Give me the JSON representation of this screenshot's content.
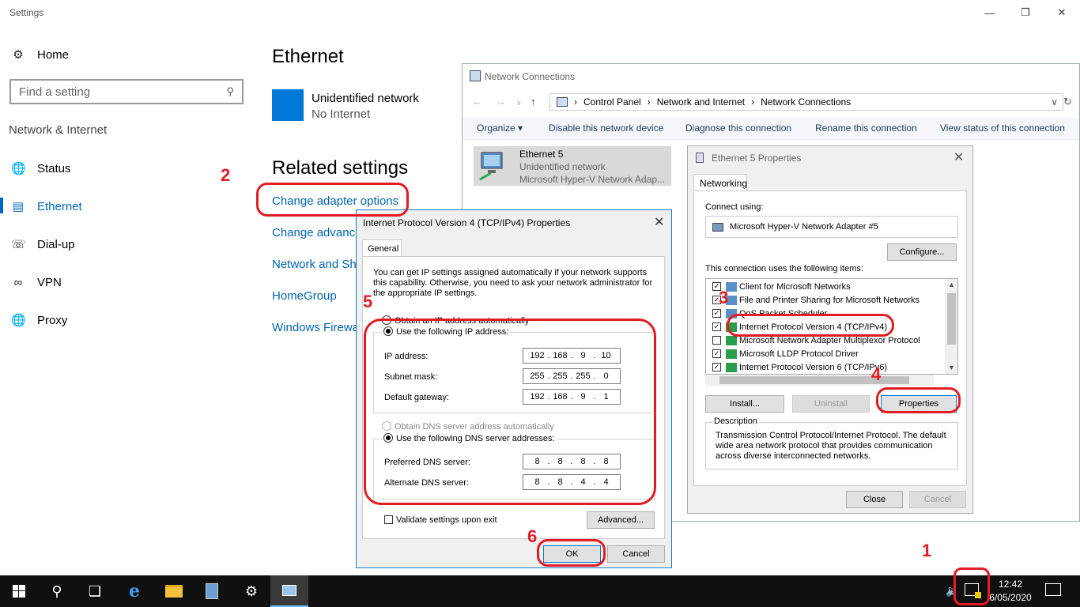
{
  "settings": {
    "window_title": "Settings",
    "home_label": "Home",
    "search_placeholder": "Find a setting",
    "section_label": "Network & Internet",
    "nav": [
      "Status",
      "Ethernet",
      "Dial-up",
      "VPN",
      "Proxy"
    ],
    "page_title": "Ethernet",
    "network_name": "Unidentified network",
    "network_status": "No Internet",
    "related_heading": "Related settings",
    "related_links": [
      "Change adapter options",
      "Change advance",
      "Network and Sh",
      "HomeGroup",
      "Windows Firewa"
    ]
  },
  "netconn": {
    "title": "Network Connections",
    "breadcrumb": [
      "Control Panel",
      "Network and Internet",
      "Network Connections"
    ],
    "toolbar": [
      "Organize",
      "Disable this network device",
      "Diagnose this connection",
      "Rename this connection",
      "View status of this connection"
    ],
    "adapter": {
      "name": "Ethernet 5",
      "status": "Unidentified network",
      "device": "Microsoft Hyper-V Network Adap..."
    }
  },
  "eth_props": {
    "title": "Ethernet 5 Properties",
    "tab": "Networking",
    "connect_using_label": "Connect using:",
    "adapter_name": "Microsoft Hyper-V Network Adapter #5",
    "configure_btn": "Configure...",
    "items_label": "This connection uses the following items:",
    "items": [
      {
        "label": "Client for Microsoft Networks",
        "checked": true
      },
      {
        "label": "File and Printer Sharing for Microsoft Networks",
        "checked": true
      },
      {
        "label": "QoS Packet Scheduler",
        "checked": true
      },
      {
        "label": "Internet Protocol Version 4 (TCP/IPv4)",
        "checked": true
      },
      {
        "label": "Microsoft Network Adapter Multiplexor Protocol",
        "checked": false
      },
      {
        "label": "Microsoft LLDP Protocol Driver",
        "checked": true
      },
      {
        "label": "Internet Protocol Version 6 (TCP/IPv6)",
        "checked": true
      }
    ],
    "install_btn": "Install...",
    "uninstall_btn": "Uninstall",
    "properties_btn": "Properties",
    "description_label": "Description",
    "description": "Transmission Control Protocol/Internet Protocol. The default wide area network protocol that provides communication across diverse interconnected networks.",
    "close_btn": "Close",
    "cancel_btn": "Cancel"
  },
  "ipv4": {
    "title": "Internet Protocol Version 4 (TCP/IPv4) Properties",
    "tab": "General",
    "intro": "You can get IP settings assigned automatically if your network supports this capability. Otherwise, you need to ask your network administrator for the appropriate IP settings.",
    "auto_ip": "Obtain an IP address automatically",
    "use_ip": "Use the following IP address:",
    "ip_label": "IP address:",
    "ip": [
      "192",
      "168",
      "9",
      "10"
    ],
    "mask_label": "Subnet mask:",
    "mask": [
      "255",
      "255",
      "255",
      "0"
    ],
    "gw_label": "Default gateway:",
    "gw": [
      "192",
      "168",
      "9",
      "1"
    ],
    "auto_dns": "Obtain DNS server address automatically",
    "use_dns": "Use the following DNS server addresses:",
    "pref_label": "Preferred DNS server:",
    "pref": [
      "8",
      "8",
      "8",
      "8"
    ],
    "alt_label": "Alternate DNS server:",
    "alt": [
      "8",
      "8",
      "4",
      "4"
    ],
    "validate": "Validate settings upon exit",
    "advanced_btn": "Advanced...",
    "ok_btn": "OK",
    "cancel_btn": "Cancel"
  },
  "annotations": [
    "1",
    "2",
    "3",
    "4",
    "5",
    "6"
  ],
  "taskbar": {
    "time": "12:42",
    "date": "6/05/2020"
  },
  "colors": {
    "accent": "#0078d7",
    "link": "#0063b1",
    "annotation": "#e31b23",
    "taskbar": "#101010"
  }
}
